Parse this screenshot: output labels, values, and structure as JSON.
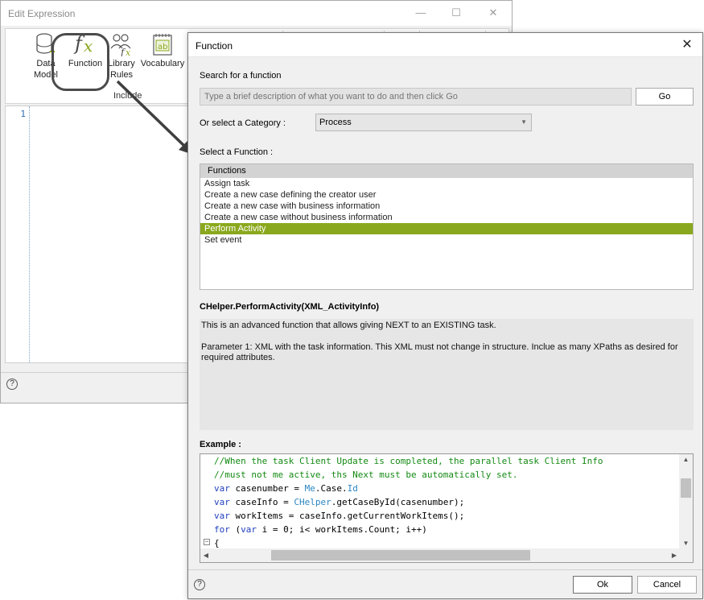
{
  "background_window": {
    "title": "Edit Expression",
    "controls": {
      "minimize": "—",
      "maximize": "☐",
      "close": "✕"
    },
    "ribbon": {
      "data_model_line1": "Data",
      "data_model_line2": "Model",
      "function_label": "Function",
      "library_rules_line1": "Library",
      "library_rules_line2": "Rules",
      "vocabulary_label": "Vocabulary",
      "group_label": "Include"
    },
    "editor": {
      "line_number": "1"
    },
    "help": "?"
  },
  "dialog": {
    "title": "Function",
    "close": "✕",
    "search_label": "Search for a function",
    "search_placeholder": "Type a brief description of what you want to do and then click Go",
    "go_button": "Go",
    "category_label": "Or select a Category :",
    "category_value": "Process",
    "select_function_label": "Select a Function :",
    "functions_header": "Functions",
    "functions": [
      "Assign task",
      "Create a new case defining the creator user",
      "Create a new case with business information",
      "Create a new case without business information",
      "Perform Activity",
      "Set event"
    ],
    "selected_function": "Perform Activity",
    "signature": "CHelper.PerformActivity(XML_ActivityInfo)",
    "description_1": "This is an advanced function that allows giving NEXT to an EXISTING task.",
    "description_2": "Parameter 1: XML with the task information. This XML must not change in structure. Inclue as many XPaths as desired for required attributes.",
    "example_label": "Example :",
    "code": {
      "l1": "//When the task Client Update is completed, the parallel task Client Info",
      "l2": "//must not me active, ths Next must be automatically set.",
      "l3_kw": "var",
      "l3_a": " casenumber = ",
      "l3_me": "Me",
      "l3_b": ".Case.",
      "l3_id": "Id",
      "l4_kw": "var",
      "l4_a": " caseInfo = ",
      "l4_ch": "CHelper",
      "l4_b": ".getCaseById(casenumber);",
      "l5_kw": "var",
      "l5_a": " workItems = caseInfo.getCurrentWorkItems();",
      "l6_kw1": "for",
      "l6_a": " (",
      "l6_kw2": "var",
      "l6_b": " i = 0; i< workItems.Count; i++)",
      "l7": "{"
    },
    "fold_marker": "−",
    "ok_button": "Ok",
    "cancel_button": "Cancel",
    "help": "?"
  },
  "colors": {
    "selection": "#8aa81d",
    "comment": "#138a13",
    "keyword": "#1f3fbf",
    "identifier": "#2a86c4"
  }
}
